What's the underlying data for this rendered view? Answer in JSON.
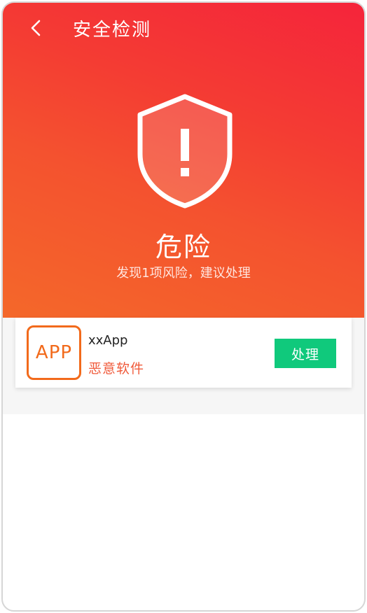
{
  "header": {
    "title": "安全检测",
    "back_icon": "chevron-left-icon"
  },
  "status": {
    "icon": "shield-alert-icon",
    "title": "危险",
    "subtitle": "发现1项风险，建议处理"
  },
  "risk_list": [
    {
      "icon_text": "APP",
      "name": "xxApp",
      "category": "恶意软件",
      "action_label": "处理"
    }
  ],
  "colors": {
    "hero_gradient_top": "#f5243b",
    "hero_gradient_bottom": "#f4682a",
    "app_icon_accent": "#f26a1b",
    "risk_text": "#f05a3a",
    "action_button": "#10c97c"
  }
}
